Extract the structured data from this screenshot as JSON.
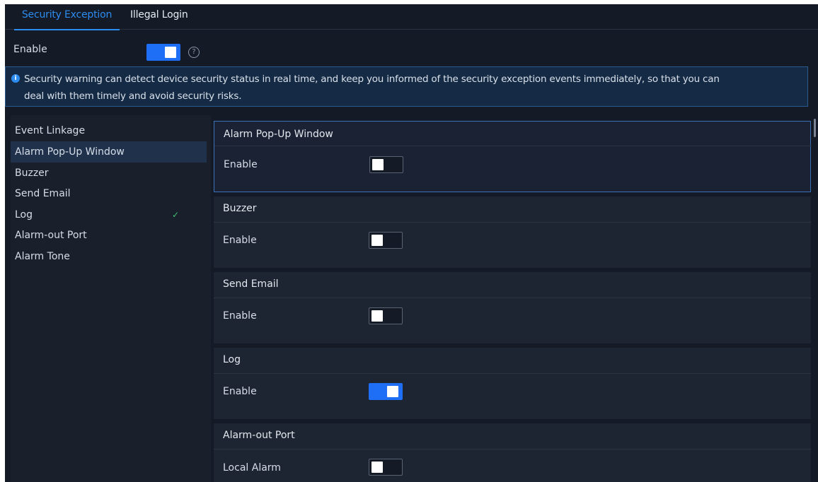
{
  "tabs": [
    "Security Exception",
    "Illegal Login"
  ],
  "master": {
    "label": "Enable",
    "enabled": true
  },
  "info": {
    "line1": "Security warning can detect device security status in real time, and keep you informed of the security exception events immediately, so that you can",
    "line2": "deal with them timely and avoid security risks."
  },
  "nav": {
    "items": [
      {
        "label": "Event Linkage"
      },
      {
        "label": "Alarm Pop-Up Window",
        "active": true
      },
      {
        "label": "Buzzer"
      },
      {
        "label": "Send Email"
      },
      {
        "label": "Log",
        "checked": true
      },
      {
        "label": "Alarm-out Port"
      },
      {
        "label": "Alarm Tone"
      }
    ]
  },
  "panels": [
    {
      "title": "Alarm Pop-Up Window",
      "row_label": "Enable",
      "on": false
    },
    {
      "title": "Buzzer",
      "row_label": "Enable",
      "on": false
    },
    {
      "title": "Send Email",
      "row_label": "Enable",
      "on": false
    },
    {
      "title": "Log",
      "row_label": "Enable",
      "on": true
    },
    {
      "title": "Alarm-out Port",
      "row_label": "Local Alarm",
      "on": false
    }
  ],
  "colors": {
    "accent": "#1e6ff5",
    "check": "#3dc26b",
    "background": "#141b27"
  },
  "icons": {
    "help": "question-circle-icon",
    "info": "info-circle-icon",
    "check": "checkmark-icon"
  }
}
